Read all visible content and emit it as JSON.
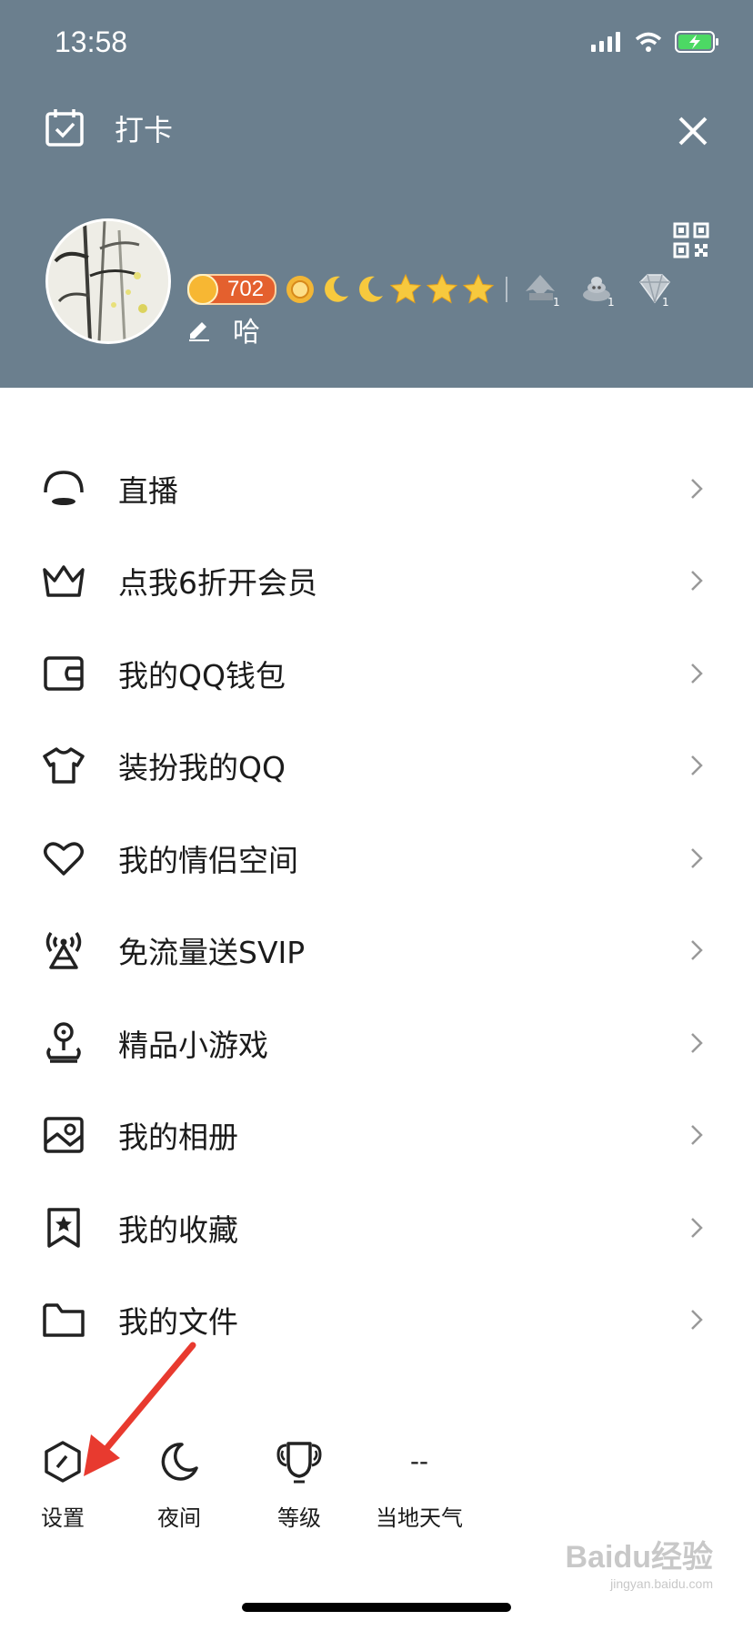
{
  "status_bar": {
    "time": "13:58"
  },
  "header": {
    "title": "打卡",
    "coin_value": "702",
    "signature": "哈"
  },
  "menu": [
    {
      "label": "直播",
      "icon": "live-icon"
    },
    {
      "label": "点我6折开会员",
      "icon": "crown-icon"
    },
    {
      "label": "我的QQ钱包",
      "icon": "wallet-icon"
    },
    {
      "label": "装扮我的QQ",
      "icon": "tshirt-icon"
    },
    {
      "label": "我的情侣空间",
      "icon": "heart-icon"
    },
    {
      "label": "免流量送SVIP",
      "icon": "signal-tower-icon"
    },
    {
      "label": "精品小游戏",
      "icon": "joystick-icon"
    },
    {
      "label": "我的相册",
      "icon": "photo-icon"
    },
    {
      "label": "我的收藏",
      "icon": "bookmark-star-icon"
    },
    {
      "label": "我的文件",
      "icon": "folder-icon"
    }
  ],
  "bottom": {
    "settings": "设置",
    "night": "夜间",
    "level": "等级",
    "weather": "当地天气",
    "weather_value": "--"
  },
  "watermark": {
    "brand": "Baidu经验",
    "url": "jingyan.baidu.com"
  },
  "colors": {
    "header_bg": "#6b7f8e",
    "accent_red": "#e83a2f"
  }
}
